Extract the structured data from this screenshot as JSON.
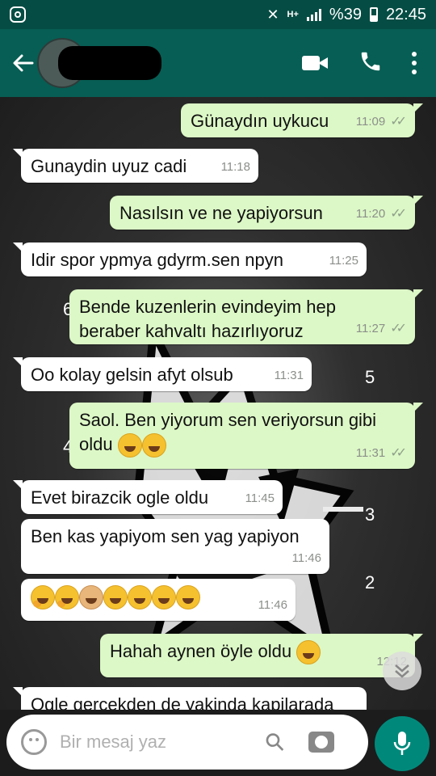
{
  "status_bar": {
    "battery": "%39",
    "time": "22:45",
    "network": "H+"
  },
  "header": {
    "contact_name": "",
    "icons": [
      "back-arrow-icon",
      "video-call-icon",
      "phone-icon",
      "more-options-icon"
    ]
  },
  "messages": [
    {
      "dir": "out",
      "text": "Günaydın uykucu",
      "time": "11:09",
      "ticks": "✓✓"
    },
    {
      "dir": "in",
      "text": "Gunaydin uyuz cadi",
      "time": "11:18"
    },
    {
      "dir": "out",
      "text": "Nasılsın ve ne yapiyorsun",
      "time": "11:20",
      "ticks": "✓✓"
    },
    {
      "dir": "in",
      "text": "Idir spor ypmya gdyrm.sen npyn",
      "time": "11:25"
    },
    {
      "dir": "out",
      "text": "Bende kuzenlerin evindeyim hep beraber  kahvaltı hazırlıyoruz",
      "time": "11:27",
      "ticks": "✓✓"
    },
    {
      "dir": "in",
      "text": "Oo kolay gelsin afyt olsub",
      "time": "11:31"
    },
    {
      "dir": "out",
      "text": "Saol. Ben yiyorum sen veriyorsun gibi oldu",
      "time": "11:31",
      "ticks": "✓✓"
    },
    {
      "dir": "in",
      "text": "Evet birazcik ogle oldu",
      "time": "11:45"
    },
    {
      "dir": "in",
      "text": "Ben kas yapiyom sen yag yapiyon",
      "time": "11:46"
    },
    {
      "dir": "in",
      "text": "",
      "time": "11:46"
    },
    {
      "dir": "out",
      "text": "Hahah aynen öyle oldu",
      "time": "12:12"
    },
    {
      "dir": "in",
      "text": "Ogle gercekden de yakinda kapilarada",
      "time": ""
    }
  ],
  "wallpaper_numbers": [
    "6",
    "5",
    "4",
    "3",
    "2"
  ],
  "input": {
    "placeholder": "Bir mesaj yaz"
  },
  "colors": {
    "header": "#075e54",
    "status_bar": "#054d44",
    "outgoing_bubble": "#dcf8c6",
    "incoming_bubble": "#ffffff",
    "mic_button": "#00897b"
  }
}
